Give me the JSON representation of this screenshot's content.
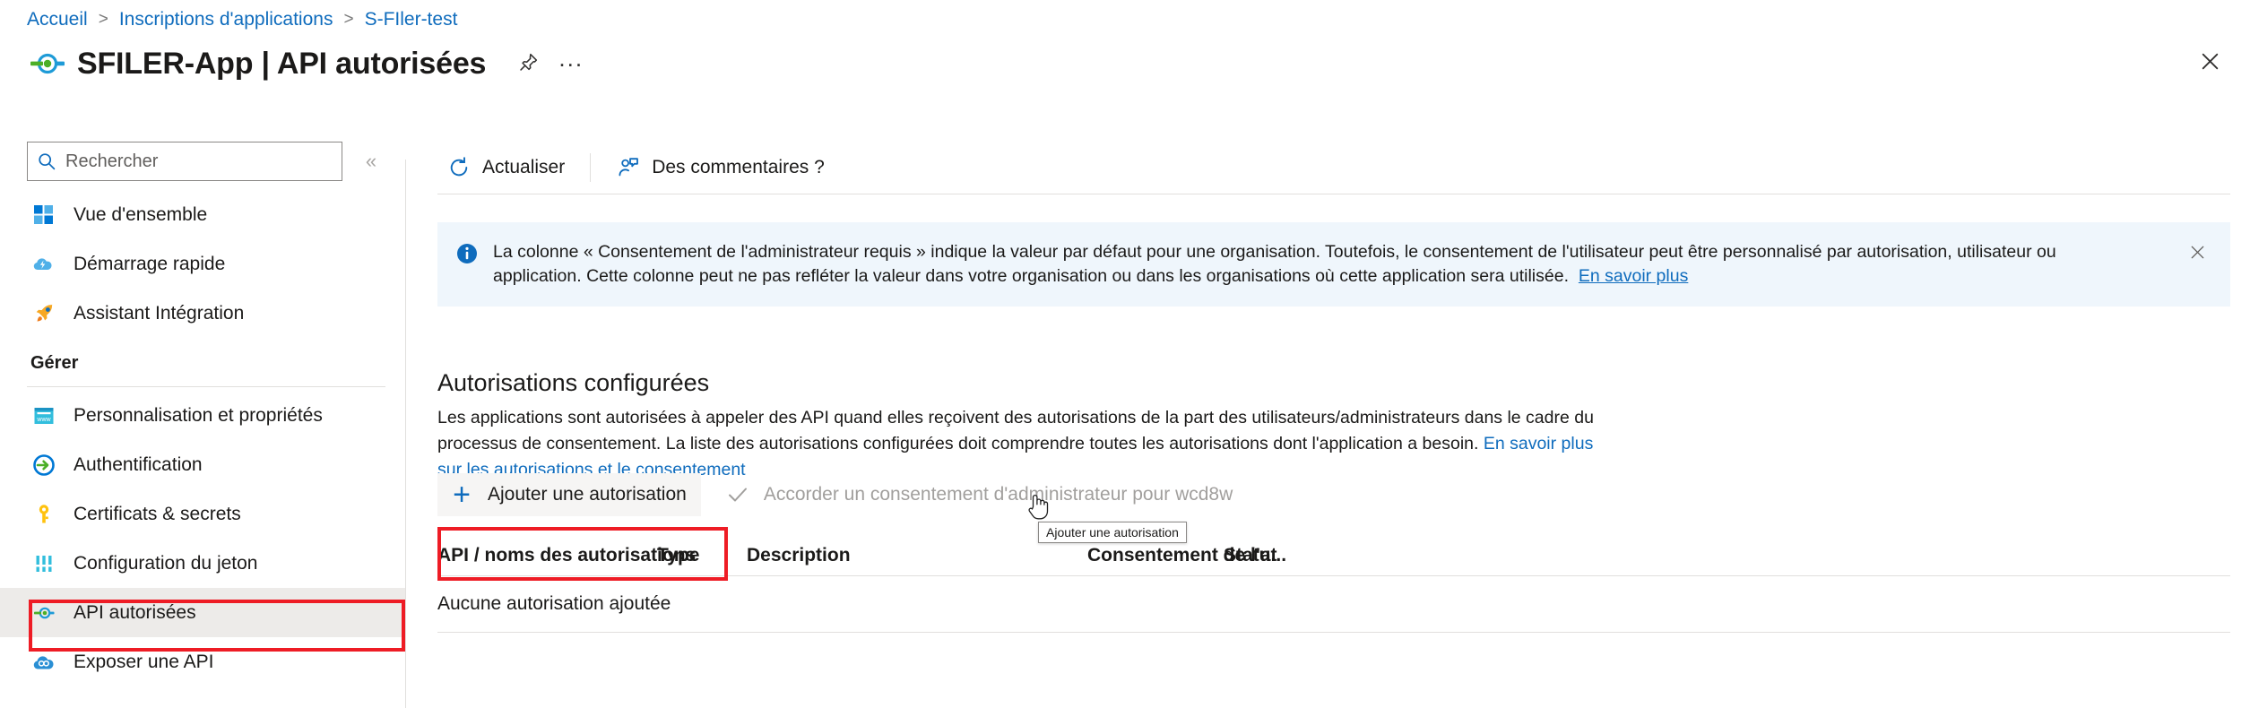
{
  "breadcrumb": {
    "items": [
      "Accueil",
      "Inscriptions d'applications",
      "S-FIler-test"
    ],
    "separator": ">"
  },
  "header": {
    "title": "SFILER-App | API autorisées",
    "pin_icon": "pin-icon",
    "more_icon": "ellipsis-icon",
    "more_label": "...",
    "close_icon": "close-icon"
  },
  "sidebar": {
    "search": {
      "placeholder": "Rechercher",
      "value": "",
      "icon": "search-icon"
    },
    "collapse_label": "«",
    "items": [
      {
        "label": "Vue d'ensemble",
        "icon": "overview-icon",
        "selected": false
      },
      {
        "label": "Démarrage rapide",
        "icon": "quickstart-cloud-icon",
        "selected": false
      },
      {
        "label": "Assistant Intégration",
        "icon": "rocket-icon",
        "selected": false
      }
    ],
    "group_label": "Gérer",
    "manage_items": [
      {
        "label": "Personnalisation et propriétés",
        "icon": "branding-www-icon",
        "selected": false
      },
      {
        "label": "Authentification",
        "icon": "authentication-arrow-icon",
        "selected": false
      },
      {
        "label": "Certificats & secrets",
        "icon": "key-icon",
        "selected": false
      },
      {
        "label": "Configuration du jeton",
        "icon": "token-bars-icon",
        "selected": false
      },
      {
        "label": "API autorisées",
        "icon": "api-permissions-icon",
        "selected": true
      },
      {
        "label": "Exposer une API",
        "icon": "expose-api-cloud-icon",
        "selected": false
      }
    ]
  },
  "toolbar": {
    "refresh_label": "Actualiser",
    "refresh_icon": "refresh-icon",
    "feedback_label": "Des commentaires ?",
    "feedback_icon": "feedback-person-icon"
  },
  "banner": {
    "icon": "info-icon",
    "text_part1": "La colonne « Consentement de l'administrateur requis » indique la valeur par défaut pour une organisation. Toutefois, le consentement de l'utilisateur peut être personnalisé par autorisation, utilisateur ou application. Cette colonne peut ne pas refléter la valeur dans votre organisation ou dans les organisations où cette application sera utilisée.",
    "link": "En savoir plus",
    "close_icon": "close-icon",
    "background": "#eff6fc"
  },
  "section": {
    "title": "Autorisations configurées",
    "desc_part1": "Les applications sont autorisées à appeler des API quand elles reçoivent des autorisations de la part des utilisateurs/administrateurs dans le cadre du processus de consentement. La liste des autorisations configurées doit comprendre toutes les autorisations dont l'application a besoin. ",
    "desc_link": "En savoir plus sur les autorisations et le consentement"
  },
  "actions": {
    "add_permission_label": "Ajouter une autorisation",
    "add_permission_icon": "plus-icon",
    "grant_consent_label": "Accorder un consentement d'administrateur pour wcd8w",
    "grant_consent_icon": "checkmark-icon",
    "tooltip": "Ajouter une autorisation"
  },
  "table": {
    "columns": [
      "API / noms des autorisations",
      "Type",
      "Description",
      "Consentement de l'a...",
      "Statut"
    ],
    "empty_message": "Aucune autorisation ajoutée"
  },
  "annotations": {
    "highlight_color": "#ee1c25"
  }
}
